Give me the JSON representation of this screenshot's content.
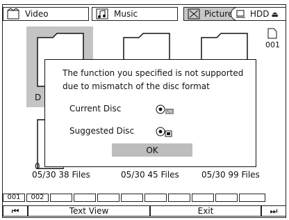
{
  "tabs": [
    {
      "label": "Video",
      "icon": "video-icon"
    },
    {
      "label": "Music",
      "icon": "music-icon"
    },
    {
      "label": "Picture",
      "icon": "picture-icon"
    },
    {
      "label": "HDD",
      "icon": "hdd-icon"
    }
  ],
  "folders": {
    "top_right_label": "001",
    "left_partial_1": "D",
    "left_partial_2": "0",
    "captions": [
      "05/30 38  Files",
      "05/30 45 Files",
      "05/30 99 Files"
    ]
  },
  "dialog": {
    "message": "The function you specified is not supported due to mismatch of the disc format",
    "current_label": "Current Disc",
    "suggested_label": "Suggested Disc",
    "current_badge": "VR",
    "ok": "OK"
  },
  "pages": [
    "001",
    "002",
    "",
    "",
    "",
    "",
    "",
    "",
    "",
    "",
    ""
  ],
  "nav": {
    "prev": "⏮",
    "text_view": "Text View",
    "exit": "Exit",
    "next": "⏭"
  },
  "colors": {
    "selected": "#c4c4c4",
    "border": "#222222"
  }
}
